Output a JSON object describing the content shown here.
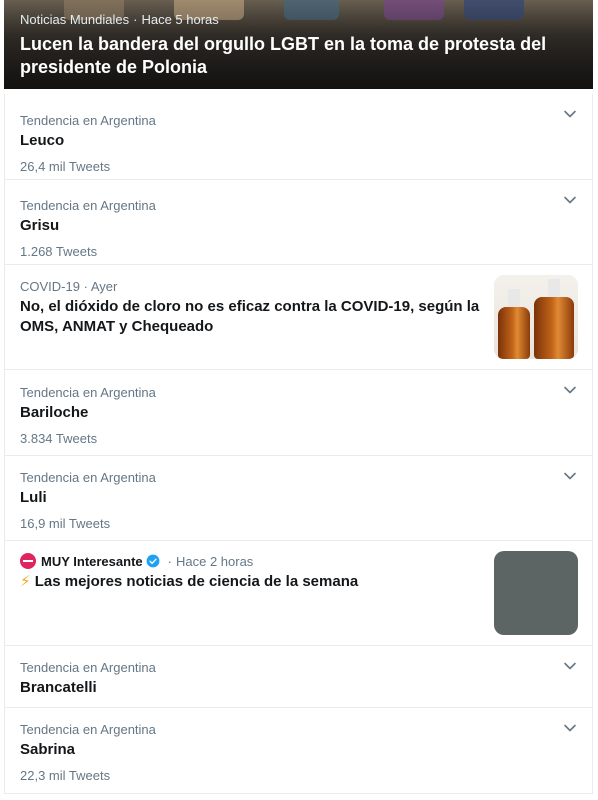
{
  "hero": {
    "category": "Noticias Mundiales",
    "separator": "·",
    "time": "Hace 5 horas",
    "title": "Lucen la bandera del orgullo LGBT en la toma de protesta del presidente de Polonia"
  },
  "trends": [
    {
      "context": "Tendencia en Argentina",
      "name": "Leuco",
      "count": "26,4 mil Tweets"
    },
    {
      "context": "Tendencia en Argentina",
      "name": "Grisu",
      "count": "1.268 Tweets"
    },
    {
      "context": "Tendencia en Argentina",
      "name": "Bariloche",
      "count": "3.834 Tweets"
    },
    {
      "context": "Tendencia en Argentina",
      "name": "Luli",
      "count": "16,9 mil Tweets"
    },
    {
      "context": "Tendencia en Argentina",
      "name": "Brancatelli",
      "count": ""
    },
    {
      "context": "Tendencia en Argentina",
      "name": "Sabrina",
      "count": "22,3 mil Tweets"
    }
  ],
  "news_covid": {
    "category": "COVID-19",
    "separator": "·",
    "time": "Ayer",
    "title": "No, el dióxido de cloro no es eficaz contra la COVID-19, según la OMS, ANMAT y Chequeado"
  },
  "news_muy": {
    "source": "MUY Interesante",
    "separator": "·",
    "time": "Hace 2 horas",
    "emoji": "⚡",
    "title": "Las mejores noticias de ciencia de la semana"
  },
  "icons": {
    "chevron": "chevron-down-icon",
    "verified": "verified-badge-icon"
  },
  "colors": {
    "secondary_text": "#657786",
    "primary_text": "#14171a",
    "accent": "#1da1f2",
    "divider": "#e6ecf0"
  }
}
